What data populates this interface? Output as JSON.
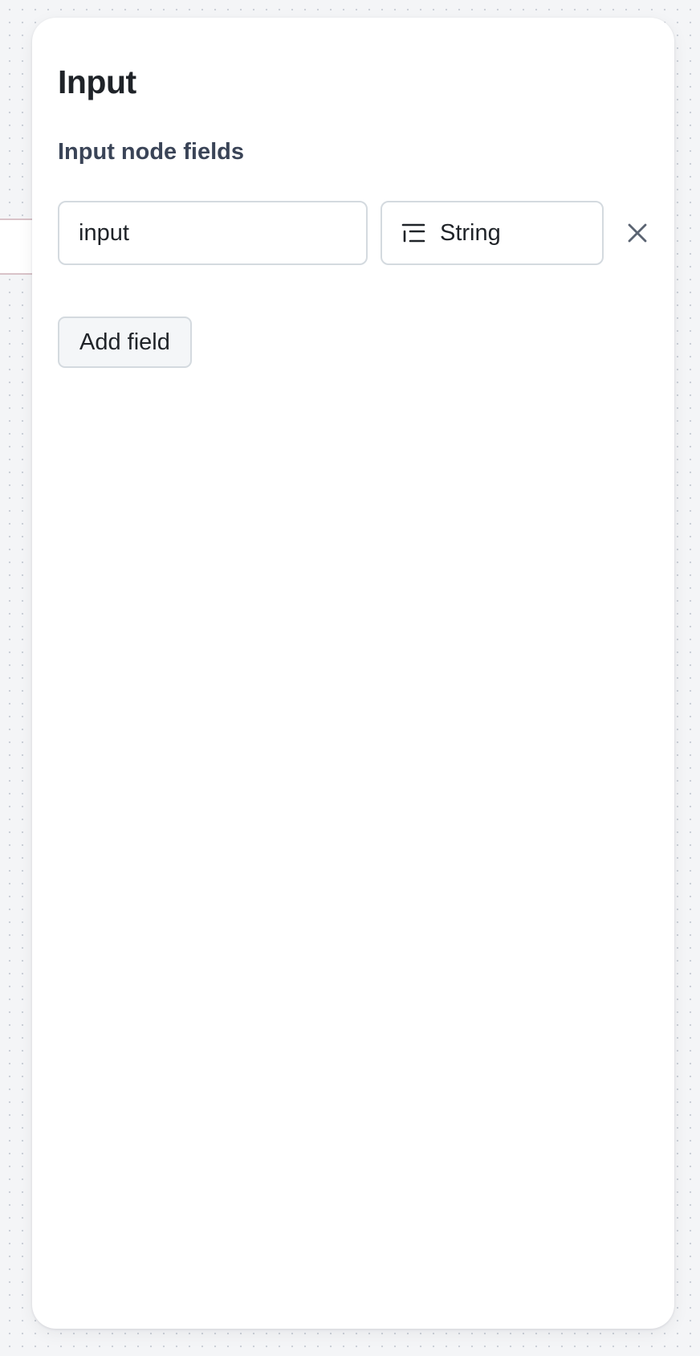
{
  "panel": {
    "title": "Input",
    "section_label": "Input node fields"
  },
  "fields": [
    {
      "name": "input",
      "type_label": "String",
      "type_icon": "text-lines-icon",
      "remove_icon": "close-icon"
    }
  ],
  "actions": {
    "add_field_label": "Add field"
  },
  "colors": {
    "text_primary": "#1f2328",
    "text_secondary": "#3a4457",
    "border": "#d4dadf",
    "button_bg": "#f4f6f8",
    "canvas_bg": "#f4f5f7"
  }
}
